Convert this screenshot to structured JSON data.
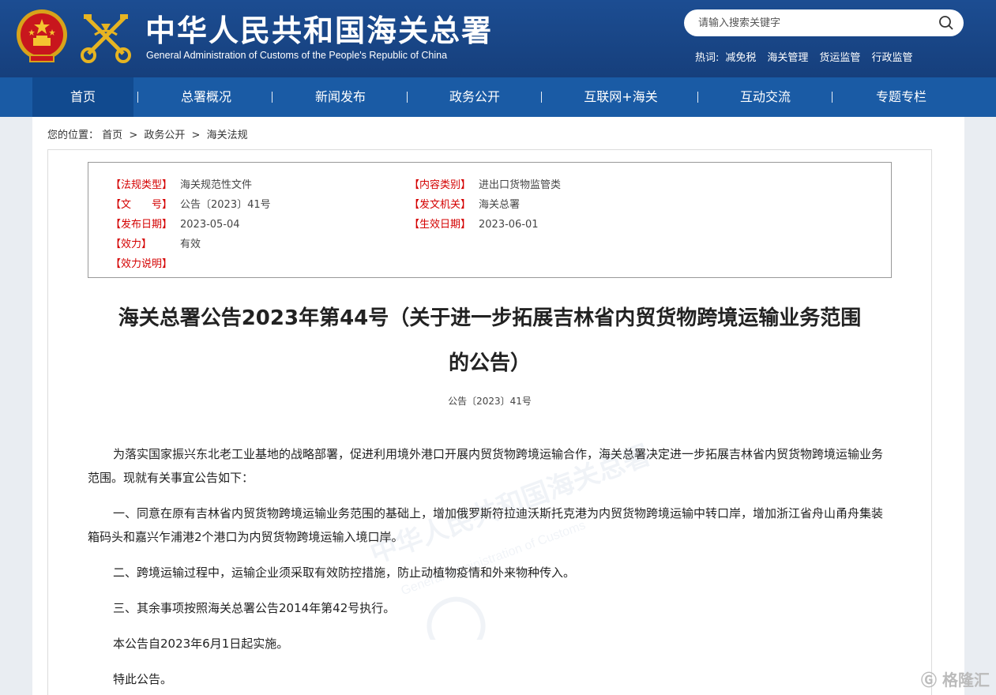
{
  "header": {
    "title": "中华人民共和国海关总署",
    "subtitle": "General Administration of Customs of the People's Republic of China",
    "search_placeholder": "请输入搜索关键字",
    "hot_label": "热词:",
    "hot_words": [
      "减免税",
      "海关管理",
      "货运监管",
      "行政监管"
    ]
  },
  "nav": {
    "items": [
      "首页",
      "总署概况",
      "新闻发布",
      "政务公开",
      "互联网+海关",
      "互动交流",
      "专题专栏"
    ],
    "active": "首页"
  },
  "breadcrumb": {
    "prefix": "您的位置：",
    "items": [
      "首页",
      "政务公开",
      "海关法规"
    ],
    "separator": ">"
  },
  "info": {
    "type_label": "【法规类型】",
    "type_value": "海关规范性文件",
    "category_label": "【内容类别】",
    "category_value": "进出口货物监管类",
    "docno_label": "【文　　号】",
    "docno_value": "公告〔2023〕41号",
    "issuer_label": "【发文机关】",
    "issuer_value": "海关总署",
    "publish_label": "【发布日期】",
    "publish_value": "2023-05-04",
    "effective_label": "【生效日期】",
    "effective_value": "2023-06-01",
    "validity_label": "【效力】",
    "validity_value": "有效",
    "validity_note_label": "【效力说明】",
    "validity_note_value": ""
  },
  "article": {
    "title_line1": "海关总署公告2023年第44号（关于进一步拓展吉林省内贸货物跨境运输业务范围",
    "title_line2": "的公告）",
    "doc_number": "公告〔2023〕41号",
    "paragraphs": [
      "为落实国家振兴东北老工业基地的战略部署，促进利用境外港口开展内贸货物跨境运输合作，海关总署决定进一步拓展吉林省内贸货物跨境运输业务范围。现就有关事宜公告如下：",
      "一、同意在原有吉林省内贸货物跨境运输业务范围的基础上，增加俄罗斯符拉迪沃斯托克港为内贸货物跨境运输中转口岸，增加浙江省舟山甬舟集装箱码头和嘉兴乍浦港2个港口为内贸货物跨境运输入境口岸。",
      "二、跨境运输过程中，运输企业须采取有效防控措施，防止动植物疫情和外来物种传入。",
      "三、其余事项按照海关总署公告2014年第42号执行。",
      "本公告自2023年6月1日起实施。",
      "特此公告。"
    ]
  },
  "corner_logo": "格隆汇",
  "colors": {
    "header_bg": "#1a4a8c",
    "nav_bg": "#1a5ba5",
    "label_red": "#d40000"
  }
}
